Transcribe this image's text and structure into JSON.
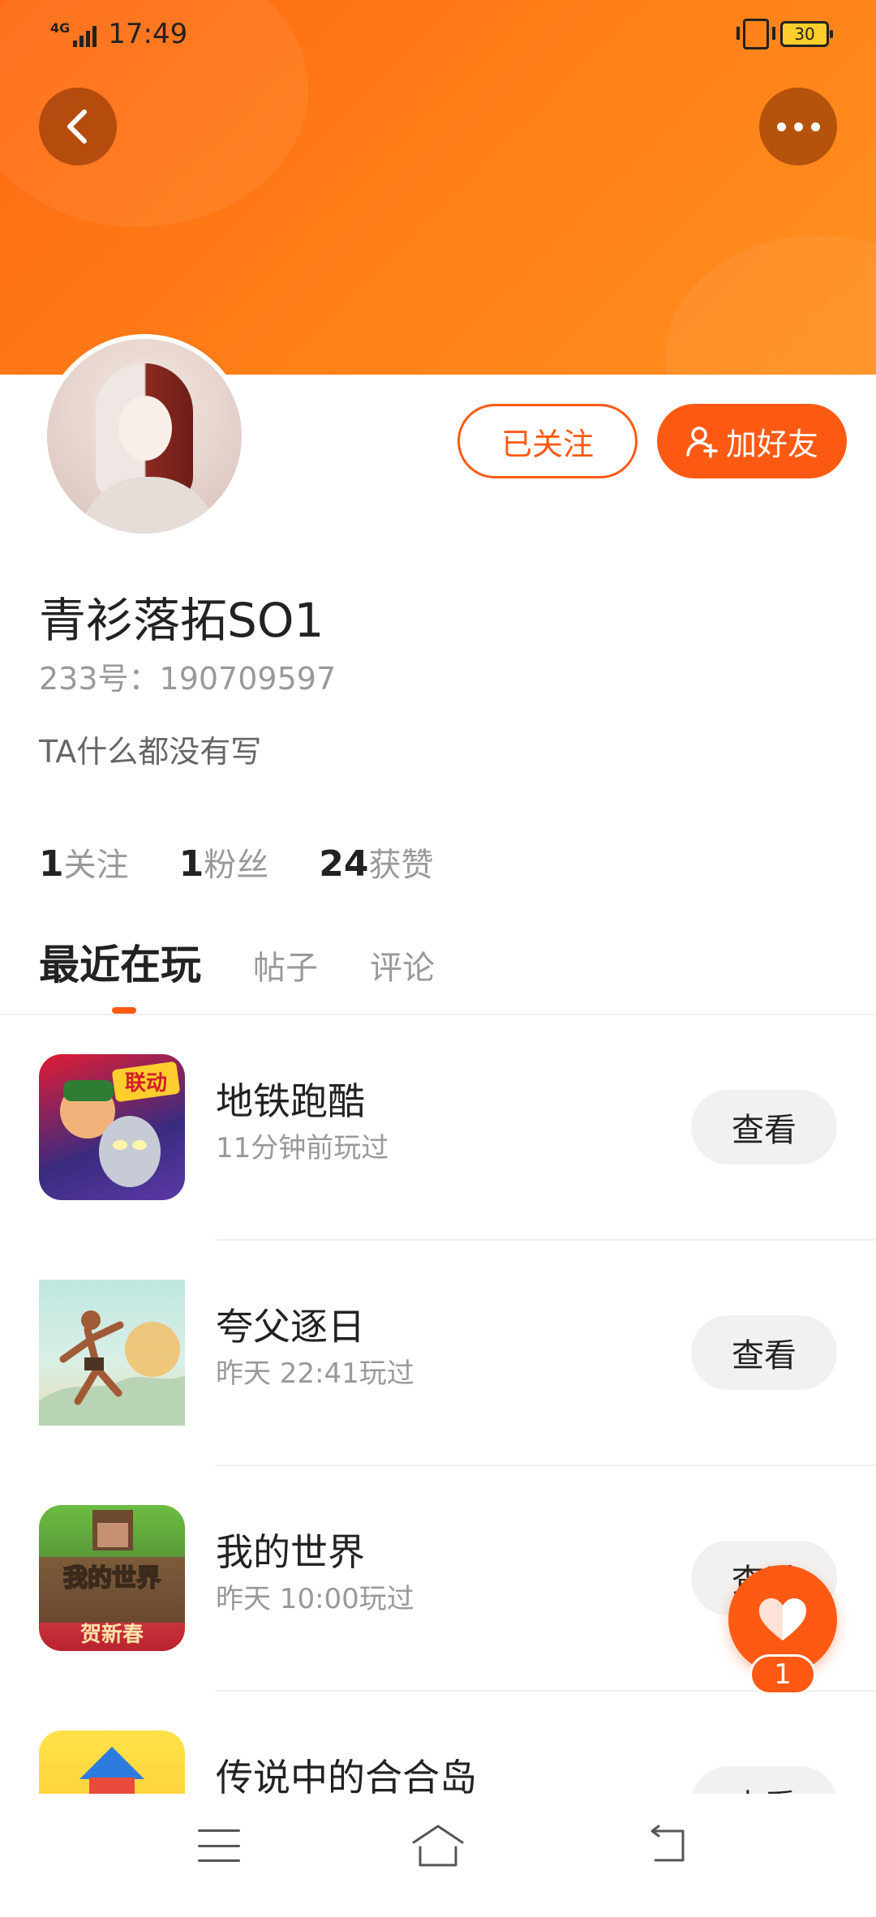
{
  "status_bar": {
    "network": "4G",
    "time": "17:49",
    "battery": "30"
  },
  "header": {
    "back_icon": "chevron-left-icon",
    "more_icon": "more-dots-icon",
    "brand_color": "#ff6a12"
  },
  "profile": {
    "name": "青衫落拓SO1",
    "id_label": "233号：190709597",
    "bio": "TA什么都没有写",
    "follow_button": "已关注",
    "add_friend_button": "加好友",
    "stats": [
      {
        "count": "1",
        "label": "关注"
      },
      {
        "count": "1",
        "label": "粉丝"
      },
      {
        "count": "24",
        "label": "获赞"
      }
    ]
  },
  "tabs": [
    {
      "label": "最近在玩",
      "active": true
    },
    {
      "label": "帖子",
      "active": false
    },
    {
      "label": "评论",
      "active": false
    }
  ],
  "games": [
    {
      "title": "地铁跑酷",
      "subtitle": "11分钟前玩过",
      "button": "查看",
      "icon_text": "联动"
    },
    {
      "title": "夸父逐日",
      "subtitle": "昨天 22:41玩过",
      "button": "查看",
      "icon_text": ""
    },
    {
      "title": "我的世界",
      "subtitle": "昨天 10:00玩过",
      "button": "查看",
      "icon_text": "我的世界",
      "icon_text2": "贺新春"
    },
    {
      "title": "传说中的合合岛",
      "subtitle": "",
      "button": "查看",
      "icon_text": ""
    }
  ],
  "like_fab": {
    "count": "1",
    "icon": "heart-icon"
  },
  "nav": {
    "menu_icon": "menu-icon",
    "home_icon": "home-icon",
    "back_icon": "back-icon"
  }
}
